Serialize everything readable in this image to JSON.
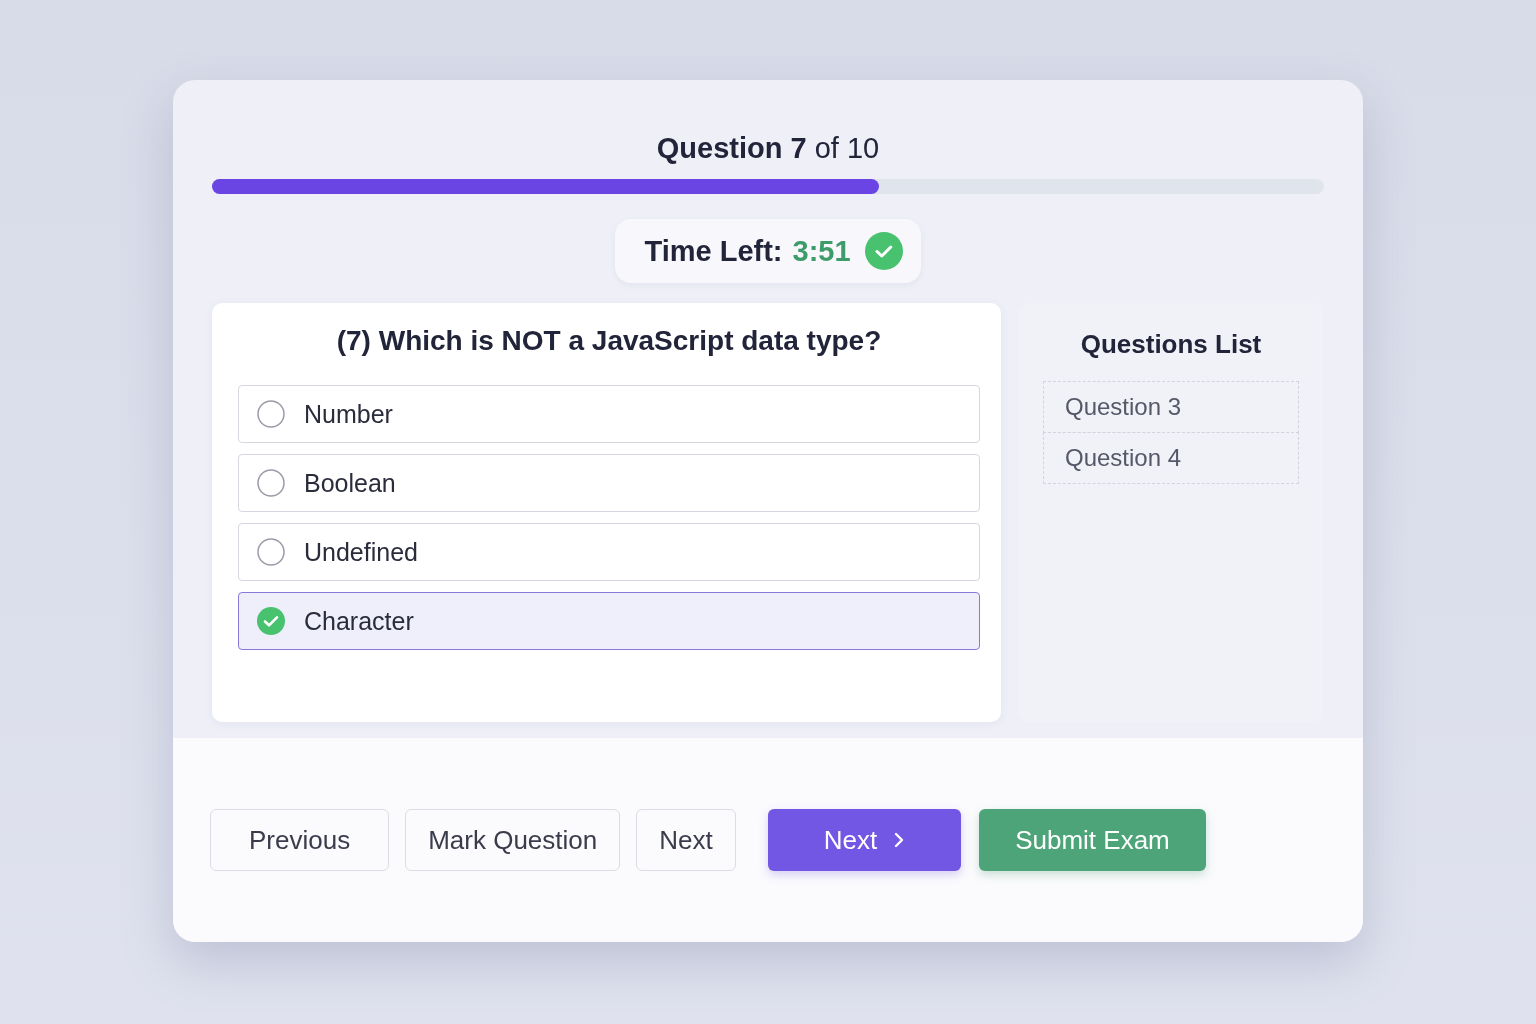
{
  "header": {
    "title": "**Question 7** of 10",
    "progress": {
      "level": 0.6
    }
  },
  "timer": {
    "label": "Time Left:",
    "value": "3:51",
    "ok": true
  },
  "question": {
    "text": "(7)  Which is NOT a JavaScript data type?",
    "options": [
      {
        "label": "Number",
        "selected": false
      },
      {
        "label": "Boolean",
        "selected": false
      },
      {
        "label": "Undefined",
        "selected": false
      },
      {
        "label": "Character",
        "selected": true
      }
    ]
  },
  "questions_list": {
    "title": "Questions List",
    "items": [
      {
        "label": "Question 3"
      },
      {
        "label": "Question 4"
      }
    ]
  },
  "buttons": [
    {
      "label": "Previous",
      "kind": "plain"
    },
    {
      "label": "Mark Question",
      "kind": "plain"
    },
    {
      "label": "Next",
      "kind": "plain"
    },
    {
      "label": "Next",
      "kind": "primary"
    },
    {
      "label": "Submit Exam",
      "kind": "success"
    }
  ]
}
